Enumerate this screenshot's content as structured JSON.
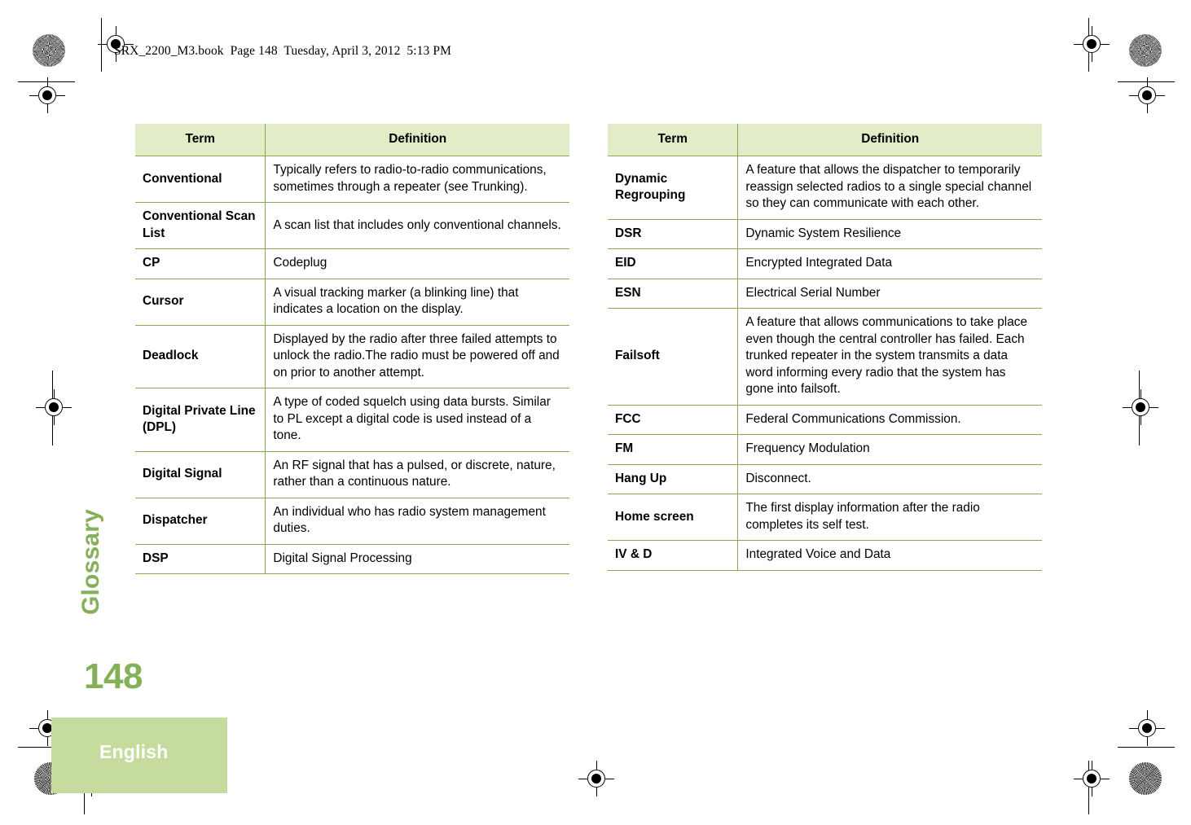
{
  "running_head": "SRX_2200_M3.book  Page 148  Tuesday, April 3, 2012  5:13 PM",
  "side_tab": {
    "label": "Glossary"
  },
  "page_number": "148",
  "footer": {
    "language": "English"
  },
  "colors": {
    "header_fill": "#e2ecc8",
    "rule": "#86a94e",
    "accent_green": "#84b05a",
    "footer_block": "#c6dc9e"
  },
  "tables": [
    {
      "id": "glossary-table-left",
      "columns": [
        "Term",
        "Definition"
      ],
      "rows": [
        {
          "term": "Conventional",
          "definition": "Typically refers to radio-to-radio communications, sometimes through a repeater (see Trunking)."
        },
        {
          "term": "Conventional Scan List",
          "definition": "A scan list that includes only conventional channels."
        },
        {
          "term": "CP",
          "definition": "Codeplug"
        },
        {
          "term": "Cursor",
          "definition": "A visual tracking marker (a blinking line) that indicates a location on the display."
        },
        {
          "term": "Deadlock",
          "definition": "Displayed by the radio after three failed attempts to unlock the radio.The radio must be powered off and on prior to another attempt."
        },
        {
          "term": "Digital Private Line (DPL)",
          "definition": "A type of coded squelch using data bursts. Similar to PL except a digital code is used instead of a tone."
        },
        {
          "term": "Digital Signal",
          "definition": "An RF signal that has a pulsed, or discrete, nature, rather than a continuous nature."
        },
        {
          "term": "Dispatcher",
          "definition": "An individual who has radio system management duties."
        },
        {
          "term": "DSP",
          "definition": "Digital Signal Processing"
        }
      ]
    },
    {
      "id": "glossary-table-right",
      "columns": [
        "Term",
        "Definition"
      ],
      "rows": [
        {
          "term": "Dynamic Regrouping",
          "definition": "A feature that allows the dispatcher to temporarily reassign selected radios to a single special channel so they can communicate with each other."
        },
        {
          "term": "DSR",
          "definition": "Dynamic System Resilience"
        },
        {
          "term": "EID",
          "definition": "Encrypted Integrated Data"
        },
        {
          "term": "ESN",
          "definition": "Electrical Serial Number"
        },
        {
          "term": "Failsoft",
          "definition": "A feature that allows communications to take place even though the central controller has failed. Each trunked repeater in the system transmits a data word informing every radio that the system has gone into failsoft."
        },
        {
          "term": "FCC",
          "definition": "Federal Communications Commission."
        },
        {
          "term": "FM",
          "definition": "Frequency Modulation"
        },
        {
          "term": "Hang Up",
          "definition": "Disconnect."
        },
        {
          "term": "Home screen",
          "definition": "The first display information after the radio completes its self test."
        },
        {
          "term": "IV & D",
          "definition": "Integrated Voice and Data"
        }
      ]
    }
  ]
}
